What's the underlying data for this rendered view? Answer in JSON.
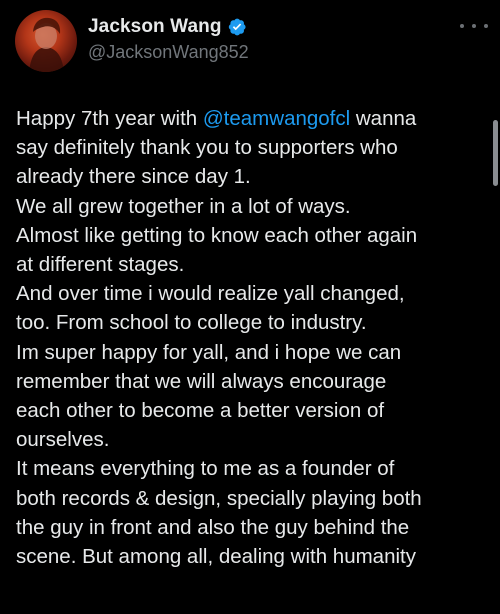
{
  "user": {
    "display_name": "Jackson Wang",
    "handle": "@JacksonWang852",
    "verified": true,
    "avatar_icon": "profile-avatar"
  },
  "icons": {
    "verified": "verified-badge-icon",
    "more": "more-options-icon"
  },
  "colors": {
    "background": "#000000",
    "text": "#e7e9ea",
    "secondary_text": "#71767b",
    "link": "#1d9bf0",
    "verified_badge": "#1d9bf0"
  },
  "tweet": {
    "line1_pre": "Happy 7th year with ",
    "mention": "@teamwangofcl",
    "line1_post": "  wanna",
    "lines": [
      "say definitely thank you to supporters who",
      "already there since day 1.",
      "We all grew together in a lot of ways.",
      "Almost like getting to know each other again",
      "at different stages.",
      "And over time i would realize yall changed,",
      "too. From school to college to industry.",
      "Im super happy for yall, and i hope we can",
      "remember that we will always encourage",
      "each other to become a better version of",
      "ourselves.",
      "It means everything to me as a founder of",
      "both records & design, specially playing both",
      "the guy in front and also the guy behind the",
      "scene. But among all, dealing with humanity"
    ]
  }
}
